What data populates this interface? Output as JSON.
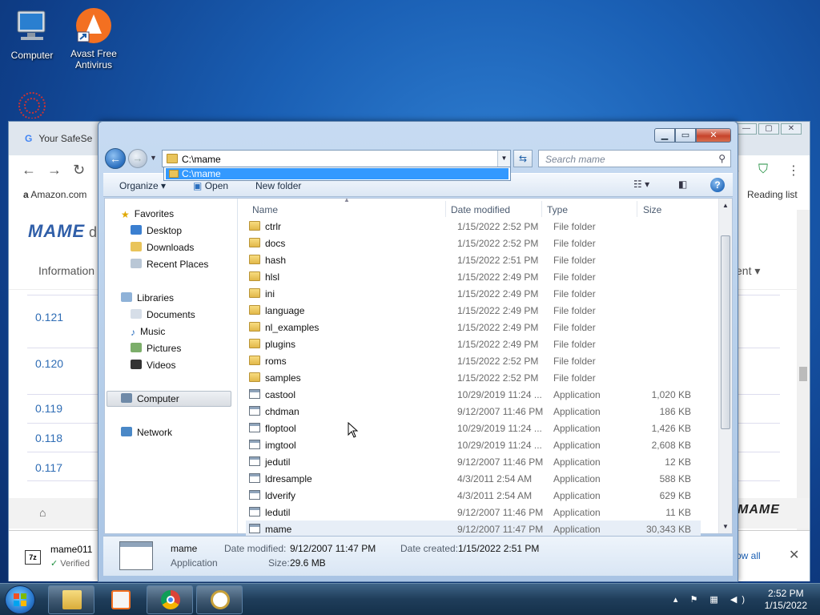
{
  "desktop": {
    "icons": [
      {
        "label": "Computer"
      },
      {
        "label": "Avast Free Antivirus"
      }
    ]
  },
  "browser": {
    "tab_title": "Your SafeSe",
    "bookmark": "Amazon.com",
    "reading_list": "Reading list",
    "site_logo": "MAME",
    "nav_info": "Information",
    "nav_right": "ent",
    "versions": [
      "0.121",
      "0.120",
      "0.119",
      "0.118",
      "0.117"
    ],
    "download_name": "mame011",
    "download_status": "Verified",
    "show_all": "ow all"
  },
  "dialog": {
    "address": "C:\\mame",
    "autocomplete": "C:\\mame",
    "search_placeholder": "Search mame",
    "toolbar": {
      "organize": "Organize",
      "open": "Open",
      "new_folder": "New folder"
    },
    "nav_pane": {
      "favorites": "Favorites",
      "desktop": "Desktop",
      "downloads": "Downloads",
      "recent": "Recent Places",
      "libraries": "Libraries",
      "documents": "Documents",
      "music": "Music",
      "pictures": "Pictures",
      "videos": "Videos",
      "computer": "Computer",
      "network": "Network"
    },
    "columns": {
      "name": "Name",
      "date": "Date modified",
      "type": "Type",
      "size": "Size"
    },
    "files": [
      {
        "name": "ctrlr",
        "date": "1/15/2022 2:52 PM",
        "type": "File folder",
        "size": "",
        "kind": "folder"
      },
      {
        "name": "docs",
        "date": "1/15/2022 2:52 PM",
        "type": "File folder",
        "size": "",
        "kind": "folder"
      },
      {
        "name": "hash",
        "date": "1/15/2022 2:51 PM",
        "type": "File folder",
        "size": "",
        "kind": "folder"
      },
      {
        "name": "hlsl",
        "date": "1/15/2022 2:49 PM",
        "type": "File folder",
        "size": "",
        "kind": "folder"
      },
      {
        "name": "ini",
        "date": "1/15/2022 2:49 PM",
        "type": "File folder",
        "size": "",
        "kind": "folder"
      },
      {
        "name": "language",
        "date": "1/15/2022 2:49 PM",
        "type": "File folder",
        "size": "",
        "kind": "folder"
      },
      {
        "name": "nl_examples",
        "date": "1/15/2022 2:49 PM",
        "type": "File folder",
        "size": "",
        "kind": "folder"
      },
      {
        "name": "plugins",
        "date": "1/15/2022 2:49 PM",
        "type": "File folder",
        "size": "",
        "kind": "folder"
      },
      {
        "name": "roms",
        "date": "1/15/2022 2:52 PM",
        "type": "File folder",
        "size": "",
        "kind": "folder"
      },
      {
        "name": "samples",
        "date": "1/15/2022 2:52 PM",
        "type": "File folder",
        "size": "",
        "kind": "folder"
      },
      {
        "name": "castool",
        "date": "10/29/2019 11:24 ...",
        "type": "Application",
        "size": "1,020 KB",
        "kind": "app"
      },
      {
        "name": "chdman",
        "date": "9/12/2007 11:46 PM",
        "type": "Application",
        "size": "186 KB",
        "kind": "app"
      },
      {
        "name": "floptool",
        "date": "10/29/2019 11:24 ...",
        "type": "Application",
        "size": "1,426 KB",
        "kind": "app"
      },
      {
        "name": "imgtool",
        "date": "10/29/2019 11:24 ...",
        "type": "Application",
        "size": "2,608 KB",
        "kind": "app"
      },
      {
        "name": "jedutil",
        "date": "9/12/2007 11:46 PM",
        "type": "Application",
        "size": "12 KB",
        "kind": "app"
      },
      {
        "name": "ldresample",
        "date": "4/3/2011 2:54 AM",
        "type": "Application",
        "size": "588 KB",
        "kind": "app"
      },
      {
        "name": "ldverify",
        "date": "4/3/2011 2:54 AM",
        "type": "Application",
        "size": "629 KB",
        "kind": "app"
      },
      {
        "name": "ledutil",
        "date": "9/12/2007 11:46 PM",
        "type": "Application",
        "size": "11 KB",
        "kind": "app"
      },
      {
        "name": "mame",
        "date": "9/12/2007 11:47 PM",
        "type": "Application",
        "size": "30,343 KB",
        "kind": "app"
      }
    ],
    "details": {
      "name": "mame",
      "type": "Application",
      "date_modified_label": "Date modified:",
      "date_modified": "9/12/2007 11:47 PM",
      "size_label": "Size:",
      "size": "29.6 MB",
      "date_created_label": "Date created:",
      "date_created": "1/15/2022 2:51 PM"
    }
  },
  "taskbar": {
    "time": "2:52 PM",
    "date": "1/15/2022"
  }
}
